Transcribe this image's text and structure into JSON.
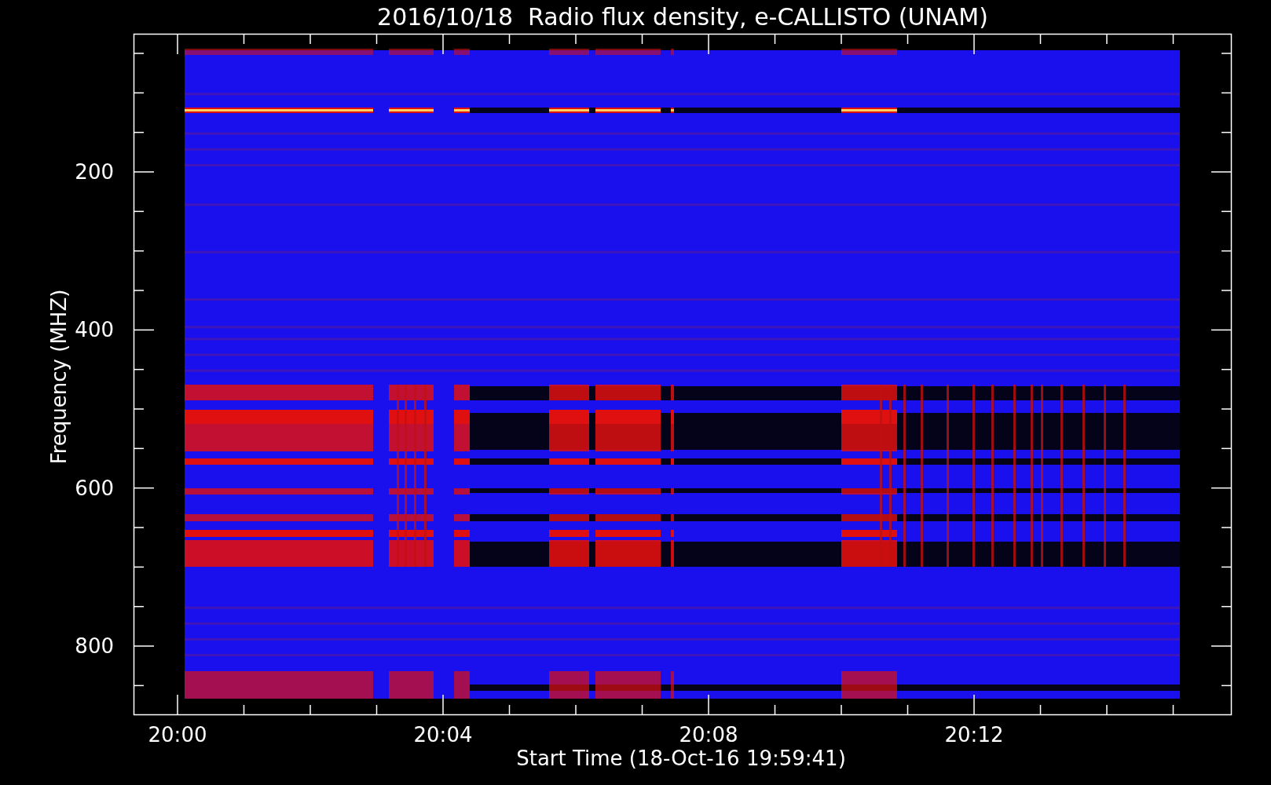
{
  "title": "2016/10/18  Radio flux density, e-CALLISTO (UNAM)",
  "y_axis": {
    "label": "Frequency (MHZ)",
    "ticks": [
      "200",
      "400",
      "600",
      "800"
    ]
  },
  "x_axis": {
    "label": "Start Time (18-Oct-16 19:59:41)",
    "ticks": [
      "20:00",
      "20:04",
      "20:08",
      "20:12"
    ]
  }
}
